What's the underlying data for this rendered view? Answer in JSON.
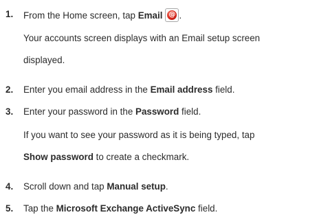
{
  "steps": [
    {
      "number": "1.",
      "line_before": "From the Home screen, tap ",
      "bold": "Email",
      "icon": "email-app-icon",
      "line_after": ".",
      "note": [
        "Your accounts screen displays with an Email setup screen",
        "displayed."
      ]
    },
    {
      "number": "2.",
      "before": "Enter you email address in the ",
      "bold": "Email address",
      "after": " field."
    },
    {
      "number": "3.",
      "before": "Enter your password in the ",
      "bold": "Password",
      "after": " field.",
      "note_line1": "If you want to see your password as it is being typed, tap",
      "note_bold": "Show password",
      "note_after": " to create a checkmark."
    },
    {
      "number": "4.",
      "before": "Scroll down and tap ",
      "bold": "Manual setup",
      "after": "."
    },
    {
      "number": "5.",
      "before": "Tap the ",
      "bold": "Microsoft Exchange ActiveSync",
      "after": " field."
    }
  ],
  "colors": {
    "text": "#2b2b2b",
    "icon_red": "#d8281c"
  }
}
